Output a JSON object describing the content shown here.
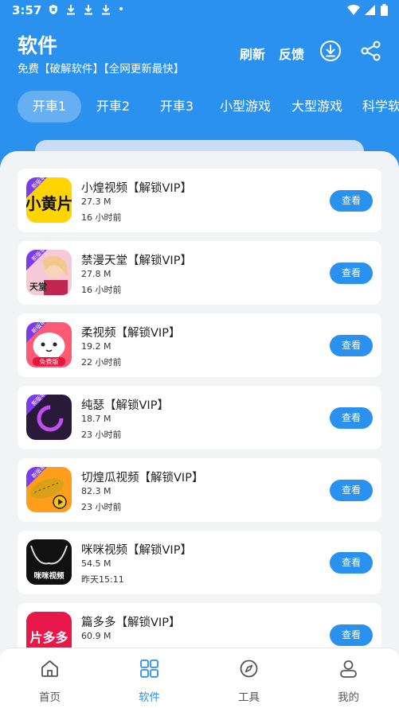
{
  "status_bar": {
    "time": "3:57",
    "dot": "•"
  },
  "header": {
    "title": "软件",
    "subtitle": "免费【破解软件】【全网更新最快】",
    "actions": {
      "refresh": "刷新",
      "feedback": "反馈"
    },
    "icons": [
      "download-icon",
      "share-icon"
    ]
  },
  "tabs": [
    "开車1",
    "开車2",
    "开車3",
    "小型游戏",
    "大型游戏",
    "科学软"
  ],
  "active_tab": 0,
  "apps": [
    {
      "name": "小煌视频【解锁VIP】",
      "size": "27.3 M",
      "time": "16 小时前",
      "action": "查看"
    },
    {
      "name": "禁漫天堂【解锁VIP】",
      "size": "27.8 M",
      "time": "16 小时前",
      "action": "查看"
    },
    {
      "name": "柔视频【解锁VIP】",
      "size": "19.2 M",
      "time": "22 小时前",
      "action": "查看"
    },
    {
      "name": "纯瑟【解锁VIP】",
      "size": "18.7 M",
      "time": "23 小时前",
      "action": "查看"
    },
    {
      "name": "切煌瓜视频【解锁VIP】",
      "size": "82.3 M",
      "time": "23 小时前",
      "action": "查看"
    },
    {
      "name": "咪咪视频【解锁VIP】",
      "size": "54.5 M",
      "time": "昨天15:11",
      "action": "查看"
    },
    {
      "name": "篇多多【解锁VIP】",
      "size": "60.9 M",
      "time": "",
      "action": "查看"
    }
  ],
  "icon_text": {
    "badge": "新版本",
    "app1": "小黄片",
    "app2": "天堂",
    "app3": "免费版",
    "app6": "咪咪视频",
    "app7": "片多多"
  },
  "bottom_nav": [
    {
      "label": "首页",
      "icon": "home-icon"
    },
    {
      "label": "软件",
      "icon": "grid-icon"
    },
    {
      "label": "工具",
      "icon": "compass-icon"
    },
    {
      "label": "我的",
      "icon": "user-icon"
    }
  ],
  "active_nav": 1,
  "colors": {
    "primary": "#2b91ef",
    "background": "#f2f3f5"
  }
}
